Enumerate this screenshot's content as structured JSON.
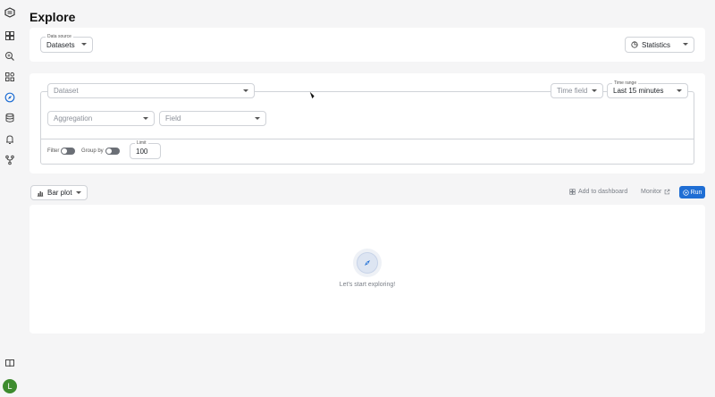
{
  "page": {
    "title": "Explore"
  },
  "sidebar": {
    "items": [
      {
        "icon": "logo-icon"
      },
      {
        "icon": "dashboard-icon"
      },
      {
        "icon": "search-zoom-icon"
      },
      {
        "icon": "apps-icon"
      },
      {
        "icon": "explore-compass-icon"
      },
      {
        "icon": "database-icon"
      },
      {
        "icon": "alert-icon"
      },
      {
        "icon": "git-branch-icon"
      },
      {
        "icon": "book-icon"
      }
    ],
    "avatar_letter": "L",
    "avatar_color": "#3d8b2e"
  },
  "data_source": {
    "label": "Data source",
    "value": "Datasets"
  },
  "mode_select": {
    "value": "Statistics"
  },
  "query": {
    "dataset_placeholder": "Dataset",
    "time_field_placeholder": "Time field",
    "time_range": {
      "label": "Time range",
      "value": "Last 15 minutes"
    },
    "aggregation_placeholder": "Aggregation",
    "field_placeholder": "Field",
    "filter_label": "Filter",
    "group_by_label": "Group by",
    "limit": {
      "label": "Limit",
      "value": "100"
    }
  },
  "results": {
    "chart_type": "Bar plot",
    "add_to_dashboard": "Add to dashboard",
    "monitor": "Monitor",
    "run": "Run",
    "empty_message": "Let's start exploring!"
  },
  "colors": {
    "accent": "#1f6ed4",
    "background": "#f5f5f6",
    "card": "#ffffff"
  }
}
